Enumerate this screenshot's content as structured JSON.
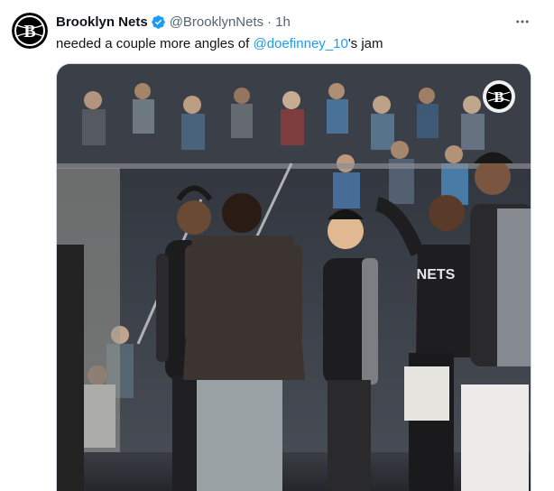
{
  "tweet": {
    "display_name": "Brooklyn Nets",
    "handle": "@BrooklynNets",
    "separator": "·",
    "time": "1h",
    "text_before": "needed a couple more angles of ",
    "mention": "@doefinney_10",
    "text_after": "'s jam",
    "jersey_text": "NETS",
    "avatar_icon": "nets-logo-icon",
    "verified_icon": "verified-badge-icon",
    "more_icon": "more-options-icon",
    "watermark_icon": "nets-watermark-icon"
  },
  "colors": {
    "accent": "#1d9bf0",
    "text": "#0f1419",
    "secondary": "#536471"
  }
}
